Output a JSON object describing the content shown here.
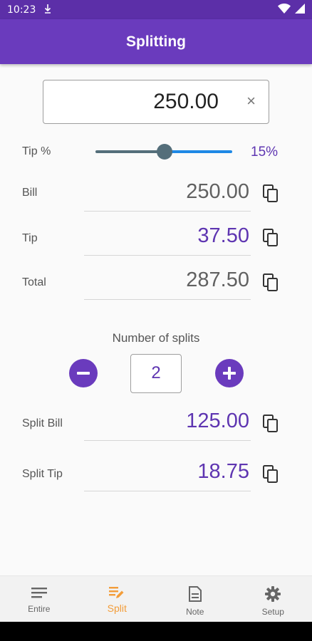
{
  "status_bar": {
    "time": "10:23",
    "download_icon": "download-arrow-icon",
    "wifi_icon": "wifi-icon",
    "battery_icon": "battery-icon"
  },
  "app_bar": {
    "title": "Splitting"
  },
  "amount_input": {
    "value": "250.00",
    "clear_symbol": "×"
  },
  "tip_slider": {
    "label": "Tip %",
    "value_text": "15%",
    "level": 0.5
  },
  "rows": [
    {
      "label": "Bill",
      "value": "250.00"
    },
    {
      "label": "Tip",
      "value": "37.50"
    },
    {
      "label": "Total",
      "value": "287.50"
    }
  ],
  "splits": {
    "title": "Number of splits",
    "count": "2"
  },
  "split_rows": [
    {
      "label": "Split Bill",
      "value": "125.00"
    },
    {
      "label": "Split Tip",
      "value": "18.75"
    }
  ],
  "bottom_nav": {
    "active": "Split",
    "items": [
      {
        "label": "Entire",
        "icon": "list-lines-icon"
      },
      {
        "label": "Split",
        "icon": "list-edit-icon"
      },
      {
        "label": "Note",
        "icon": "note-document-icon"
      },
      {
        "label": "Setup",
        "icon": "gear-icon"
      }
    ]
  },
  "colors": {
    "primary": "#6a3bbd",
    "accent_text": "#5e35b1",
    "nav_active": "#f39d3a",
    "slider_active": "#1e88e5"
  }
}
